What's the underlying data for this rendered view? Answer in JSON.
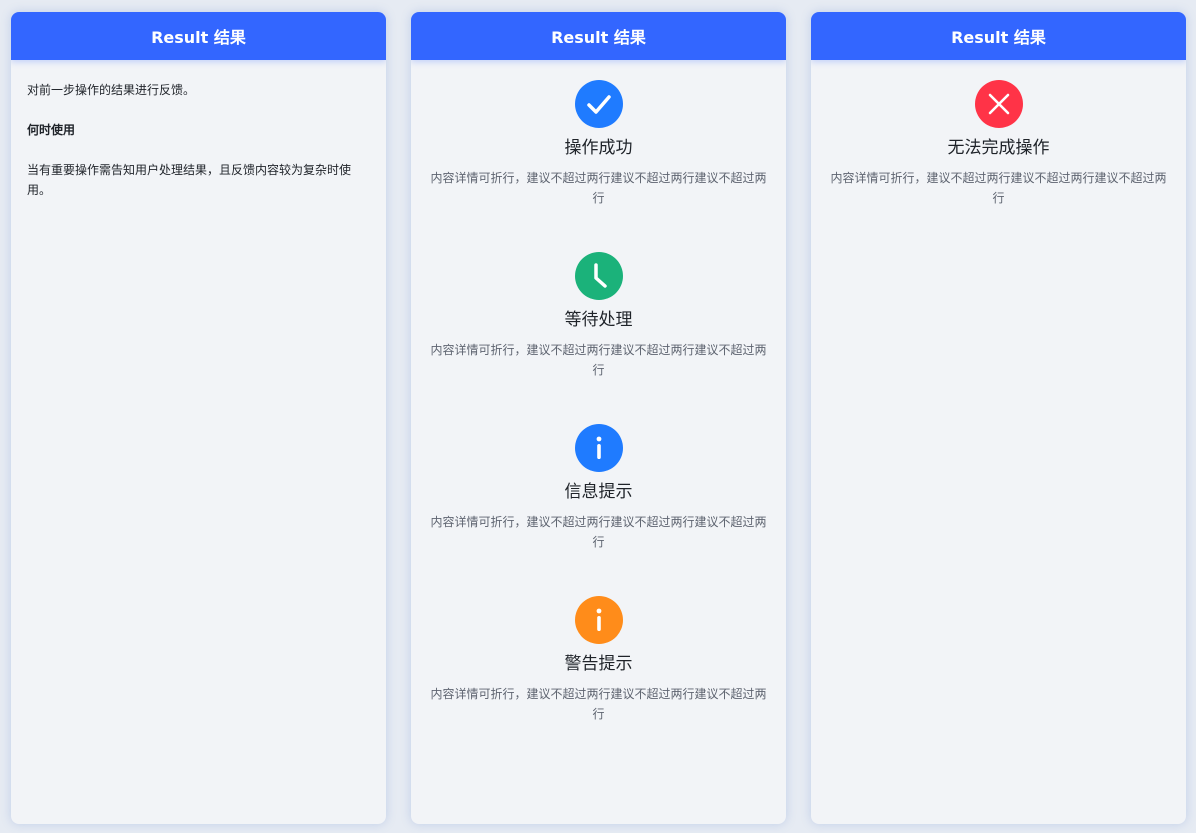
{
  "panels": [
    {
      "header": "Result 结果"
    },
    {
      "header": "Result 结果"
    },
    {
      "header": "Result 结果"
    }
  ],
  "intro": {
    "line1": "对前一步操作的结果进行反馈。",
    "heading": "何时使用",
    "line2": "当有重要操作需告知用户处理结果，且反馈内容较为复杂时使用。"
  },
  "results": [
    {
      "icon": "check-icon",
      "color": "#1f7bff",
      "title": "操作成功",
      "desc": "内容详情可折行，建议不超过两行建议不超过两行建议不超过两行"
    },
    {
      "icon": "clock-icon",
      "color": "#1bb27a",
      "title": "等待处理",
      "desc": "内容详情可折行，建议不超过两行建议不超过两行建议不超过两行"
    },
    {
      "icon": "info-icon",
      "color": "#1f7bff",
      "title": "信息提示",
      "desc": "内容详情可折行，建议不超过两行建议不超过两行建议不超过两行"
    },
    {
      "icon": "warning-icon",
      "color": "#ff8c1a",
      "title": "警告提示",
      "desc": "内容详情可折行，建议不超过两行建议不超过两行建议不超过两行"
    }
  ],
  "error_result": {
    "icon": "close-icon",
    "color": "#ff3347",
    "title": "无法完成操作",
    "desc": "内容详情可折行，建议不超过两行建议不超过两行建议不超过两行"
  }
}
